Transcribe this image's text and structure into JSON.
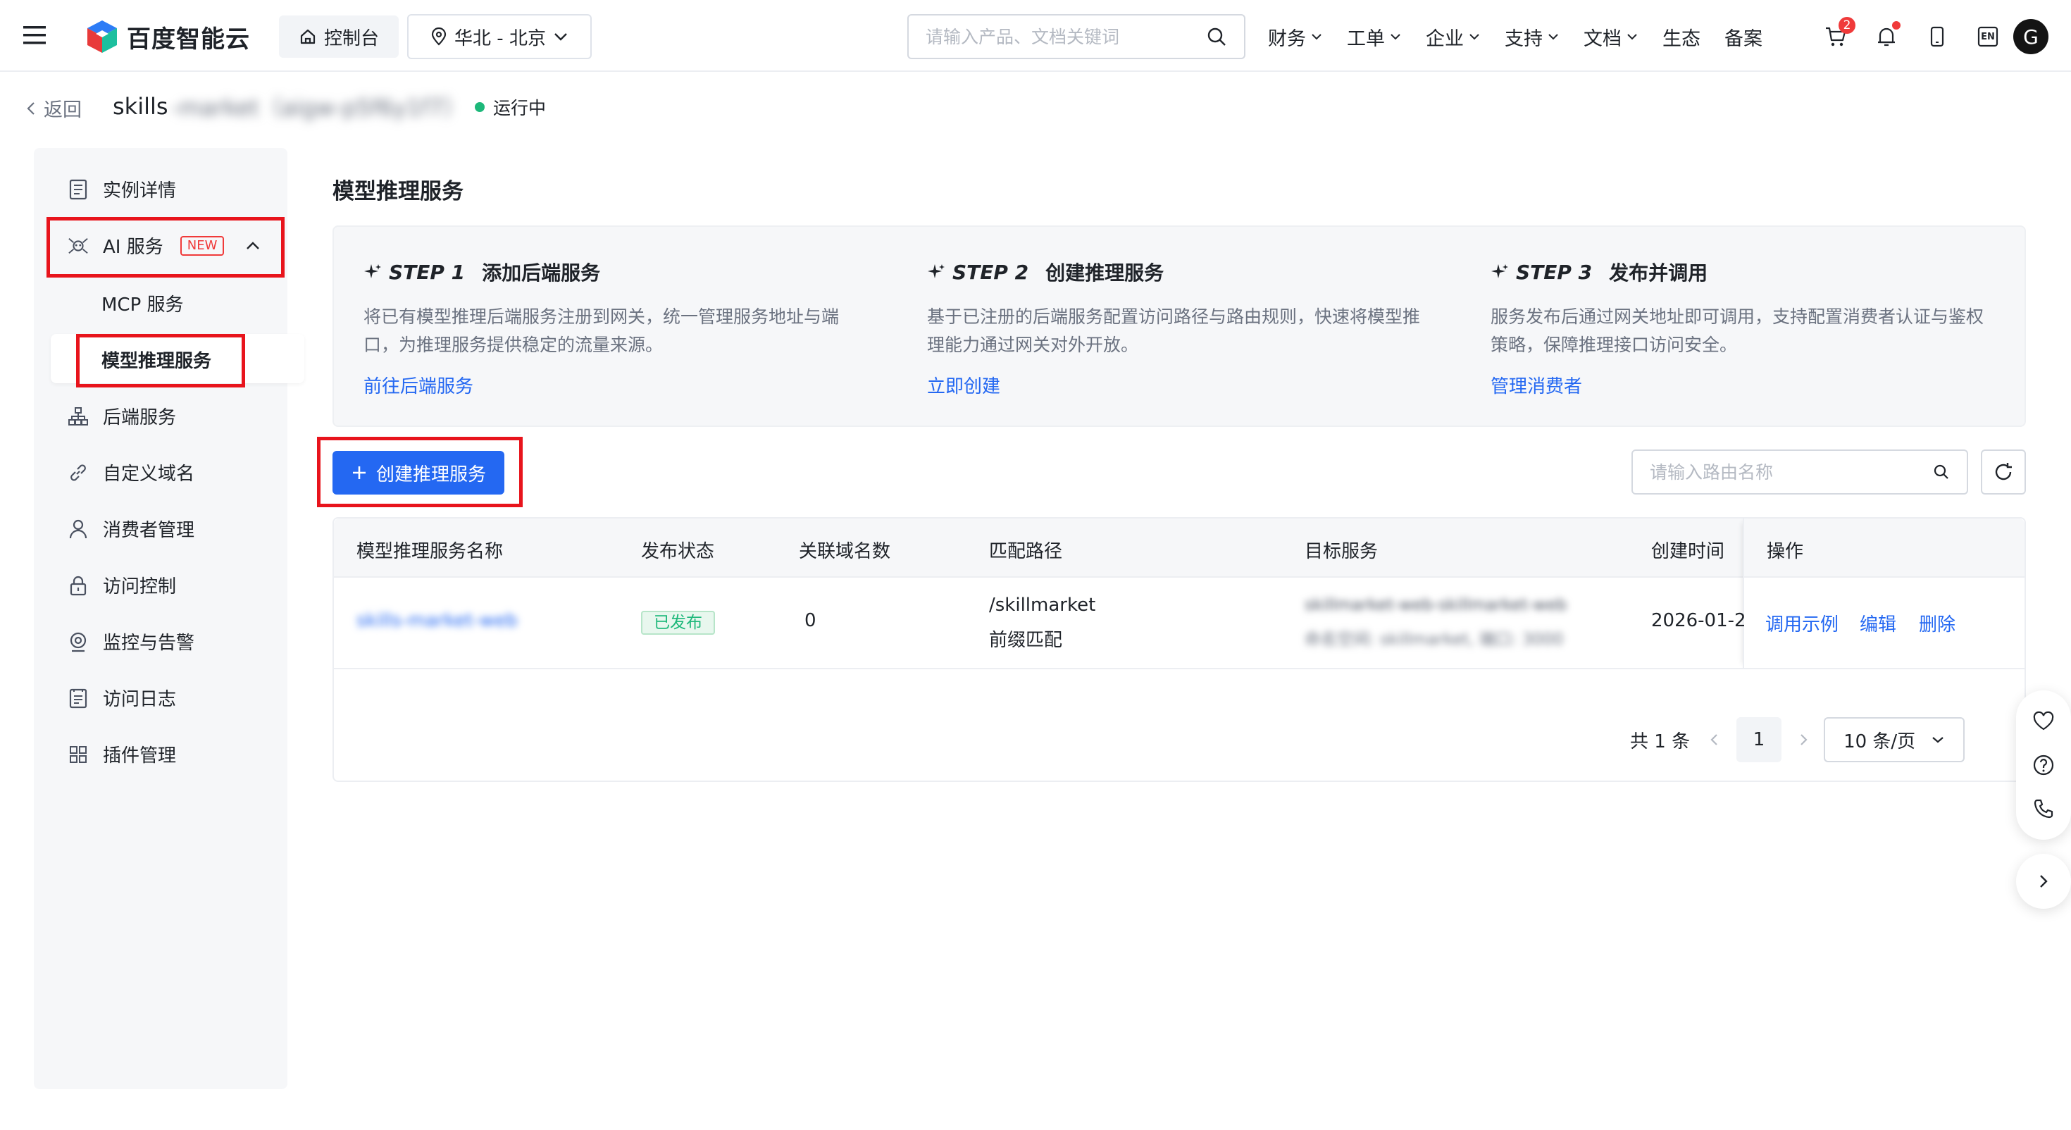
{
  "brand": {
    "name": "百度智能云"
  },
  "header": {
    "console_label": "控制台",
    "region_label": "华北 - 北京",
    "search_placeholder": "请输入产品、文档关键词",
    "nav": [
      {
        "label": "财务",
        "dropdown": true
      },
      {
        "label": "工单",
        "dropdown": true
      },
      {
        "label": "企业",
        "dropdown": true
      },
      {
        "label": "支持",
        "dropdown": true
      },
      {
        "label": "文档",
        "dropdown": true
      },
      {
        "label": "生态",
        "dropdown": false
      },
      {
        "label": "备案",
        "dropdown": false
      }
    ],
    "cart_badge": "2",
    "lang_label": "EN",
    "avatar_letter": "G"
  },
  "breadcrumb": {
    "back_label": "返回",
    "instance_name": "skills",
    "instance_name_blurred": "-market（aigw-p5f6y1f7）",
    "status_label": "运行中",
    "status_color": "#1db87a"
  },
  "sidebar": {
    "items": [
      {
        "label": "实例详情",
        "icon": "document-list-icon"
      },
      {
        "label": "AI 服务",
        "icon": "ai-robot-icon",
        "tag": "NEW",
        "expanded": true
      },
      {
        "label": "后端服务",
        "icon": "org-tree-icon"
      },
      {
        "label": "自定义域名",
        "icon": "link-icon"
      },
      {
        "label": "消费者管理",
        "icon": "user-icon"
      },
      {
        "label": "访问控制",
        "icon": "lock-icon"
      },
      {
        "label": "监控与告警",
        "icon": "monitor-icon"
      },
      {
        "label": "访问日志",
        "icon": "log-icon"
      },
      {
        "label": "插件管理",
        "icon": "grid-icon"
      }
    ],
    "subitems": [
      {
        "label": "MCP 服务",
        "active": false
      },
      {
        "label": "模型推理服务",
        "active": true
      }
    ]
  },
  "main": {
    "title": "模型推理服务",
    "steps": [
      {
        "num": "STEP 1",
        "title": "添加后端服务",
        "desc": "将已有模型推理后端服务注册到网关，统一管理服务地址与端口，为推理服务提供稳定的流量来源。",
        "link": "前往后端服务"
      },
      {
        "num": "STEP 2",
        "title": "创建推理服务",
        "desc": "基于已注册的后端服务配置访问路径与路由规则，快速将模型推理能力通过网关对外开放。",
        "link": "立即创建"
      },
      {
        "num": "STEP 3",
        "title": "发布并调用",
        "desc": "服务发布后通过网关地址即可调用，支持配置消费者认证与鉴权策略，保障推理接口访问安全。",
        "link": "管理消费者"
      }
    ],
    "create_button": "创建推理服务",
    "route_search_placeholder": "请输入路由名称",
    "table": {
      "columns": [
        "模型推理服务名称",
        "发布状态",
        "关联域名数",
        "匹配路径",
        "目标服务",
        "创建时间",
        "操作"
      ],
      "rows": [
        {
          "name": "skills-market-web",
          "status": "已发布",
          "domain_count": "0",
          "path": "/skillmarket",
          "path_type": "前缀匹配",
          "target_line1": "skillmarket-web-skillmarket-web",
          "target_line2": "命名空间: skillmarket, 端口: 3000",
          "created": "2026-01-2",
          "actions": [
            "调用示例",
            "编辑",
            "删除"
          ]
        }
      ]
    },
    "pagination": {
      "total_label": "共 1 条",
      "current_page": "1",
      "page_size_label": "10 条/页"
    }
  },
  "colors": {
    "accent": "#2468f2",
    "highlight": "#e8141c",
    "success": "#1db87a"
  }
}
